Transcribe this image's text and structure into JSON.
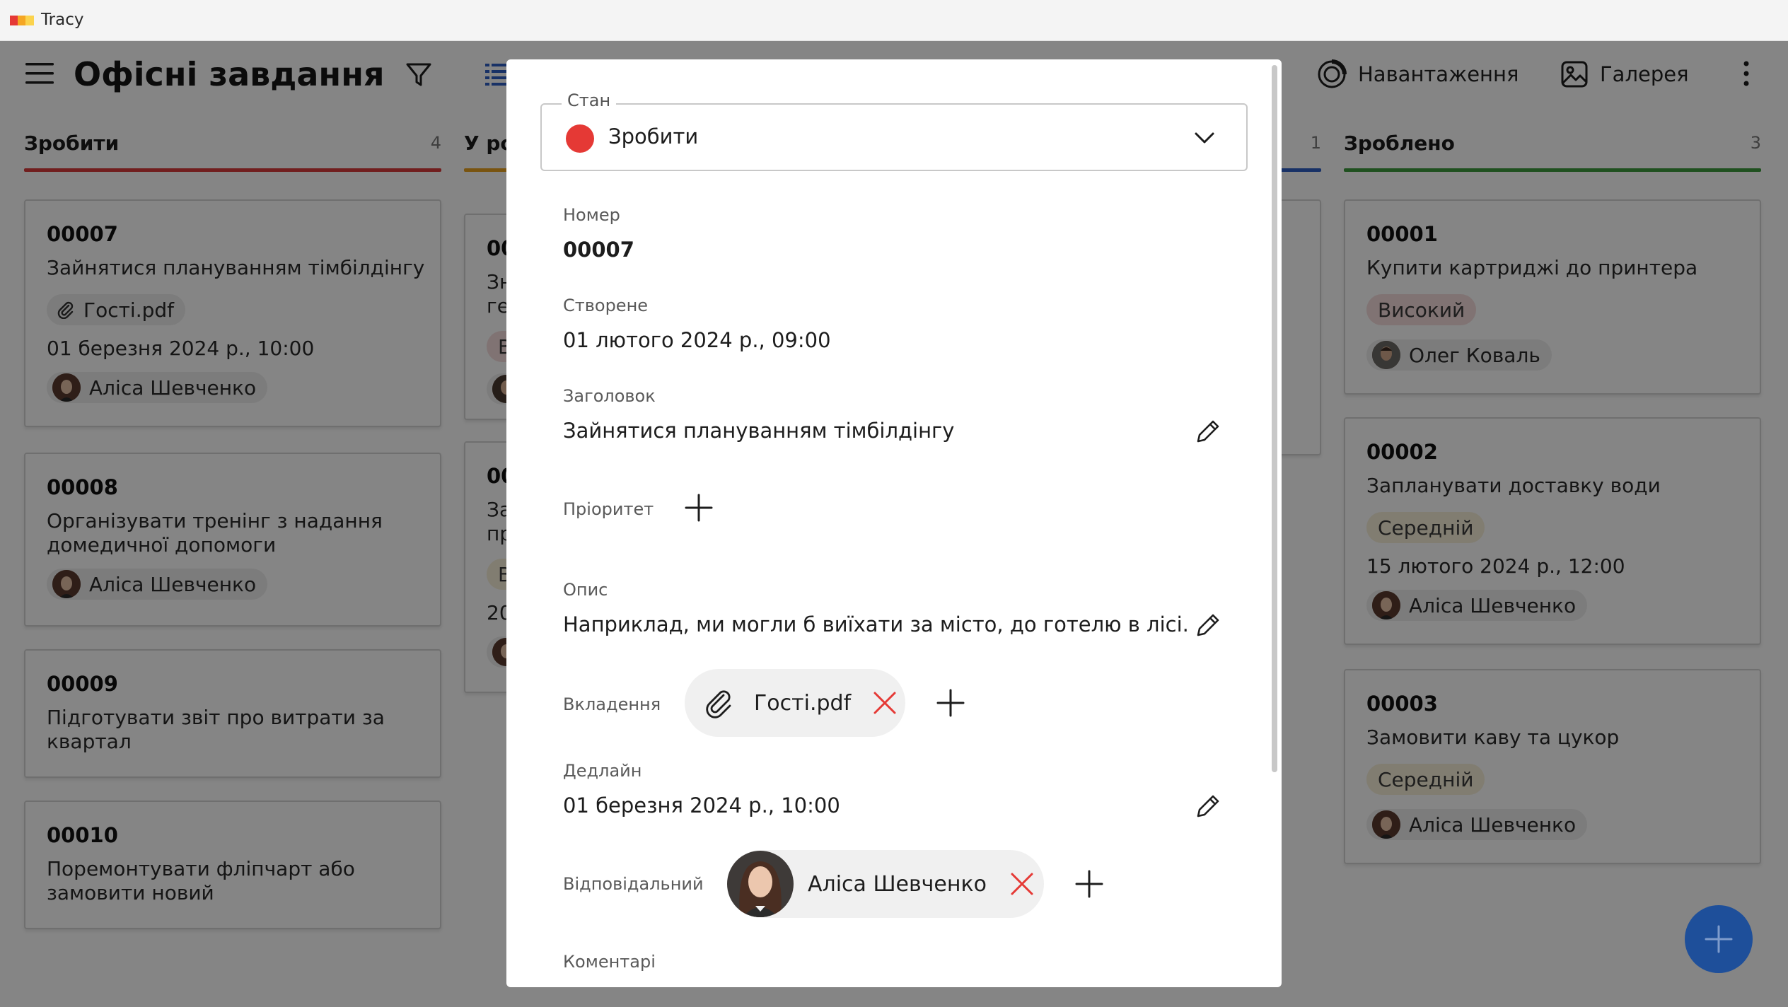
{
  "window": {
    "title": "Tracy"
  },
  "header": {
    "title": "Офісні завдання",
    "workload_label": "Навантаження",
    "gallery_label": "Галерея"
  },
  "columns": [
    {
      "title": "Зробити",
      "count": "4",
      "color": "#d93a3a",
      "cards": [
        {
          "num": "00007",
          "title": "Зайнятися плануванням тімбілдінгу",
          "attachment": "Гості.pdf",
          "date": "01 березня 2024 р., 10:00",
          "assignee": "Аліса Шевченко"
        },
        {
          "num": "00008",
          "title": "Організувати тренінг з надання домедичної допомоги",
          "assignee": "Аліса Шевченко"
        },
        {
          "num": "00009",
          "title": "Підготувати звіт про витрати за квартал"
        },
        {
          "num": "00010",
          "title": "Поремонтувати фліпчарт або замовити новий"
        }
      ]
    },
    {
      "title": "У ро",
      "color": "#e8a21f",
      "cards": [
        {
          "num": "00",
          "title_lines": [
            "Зн",
            "ге"
          ],
          "prio": "В"
        },
        {
          "num": "00",
          "title_lines": [
            "За",
            "пр"
          ],
          "prio": "В",
          "date": "20"
        }
      ]
    },
    {
      "count": "1",
      "color": "#2f5fc4"
    },
    {
      "title": "Зроблено",
      "count": "3",
      "color": "#3c9a3c",
      "cards": [
        {
          "num": "00001",
          "title": "Купити картриджі до принтера",
          "priority": "Високий",
          "assignee": "Олег Коваль"
        },
        {
          "num": "00002",
          "title": "Запланувати доставку води",
          "priority": "Середній",
          "date": "15 лютого 2024 р., 12:00",
          "assignee": "Аліса Шевченко"
        },
        {
          "num": "00003",
          "title": "Замовити каву та цукор",
          "priority": "Середній",
          "assignee": "Аліса Шевченко"
        }
      ]
    }
  ],
  "dialog": {
    "state_label": "Стан",
    "state_value": "Зробити",
    "state_color": "#e53935",
    "number_label": "Номер",
    "number_value": "00007",
    "created_label": "Створене",
    "created_value": "01 лютого 2024 р., 09:00",
    "title_label": "Заголовок",
    "title_value": "Зайнятися плануванням тімбілдінгу",
    "priority_label": "Пріоритет",
    "description_label": "Опис",
    "description_value": "Наприклад, ми могли б виїхати за місто, до готелю в лісі.",
    "attachments_label": "Вкладення",
    "attachment_name": "Гості.pdf",
    "deadline_label": "Дедлайн",
    "deadline_value": "01 березня 2024 р., 10:00",
    "assignee_label": "Відповідальний",
    "assignee_name": "Аліса Шевченко",
    "comments_label": "Коментарі"
  },
  "colors": {
    "accent": "#1e4f9a",
    "delete": "#e53935",
    "priority_high_bg": "#f6dcdc",
    "priority_mid_bg": "#f7efd8"
  }
}
